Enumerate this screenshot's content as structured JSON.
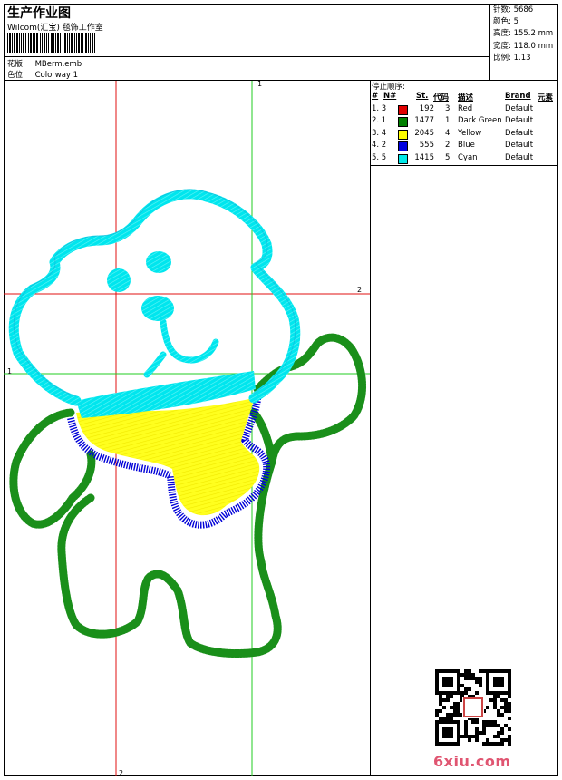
{
  "header": {
    "title": "生产作业图",
    "subtitle": "Wilcom(汇宝) 毯饰工作室",
    "pattern_label": "花版:",
    "pattern_value": "MBerm.emb",
    "colorway_label": "色位:",
    "colorway_value": "Colorway 1"
  },
  "stats": [
    {
      "label": "针数:",
      "value": "5686"
    },
    {
      "label": "颜色:",
      "value": "5"
    },
    {
      "label": "高度:",
      "value": "155.2 mm"
    },
    {
      "label": "宽度:",
      "value": "118.0 mm"
    },
    {
      "label": "比例:",
      "value": "1.13"
    }
  ],
  "legend": {
    "stop_order_label": "停止顺序:",
    "headers": {
      "num": "#",
      "n": "N#",
      "st": "St.",
      "code": "代码",
      "desc": "描述",
      "brand": "Brand",
      "element": "元素"
    },
    "rows": [
      {
        "order": "1. 3",
        "color": "#e00000",
        "st": "192",
        "code": "3",
        "desc": "Red",
        "brand": "Default"
      },
      {
        "order": "2. 1",
        "color": "#008000",
        "st": "1477",
        "code": "1",
        "desc": "Dark Green",
        "brand": "Default"
      },
      {
        "order": "3. 4",
        "color": "#ffff00",
        "st": "2045",
        "code": "4",
        "desc": "Yellow",
        "brand": "Default"
      },
      {
        "order": "4. 2",
        "color": "#0000e0",
        "st": "555",
        "code": "2",
        "desc": "Blue",
        "brand": "Default"
      },
      {
        "order": "5. 5",
        "color": "#00e8e8",
        "st": "1415",
        "code": "5",
        "desc": "Cyan",
        "brand": "Default"
      }
    ]
  },
  "guides": {
    "green_vertical_label": "1",
    "green_horizontal_label": "1",
    "red_horizontal_label": "2",
    "red_vertical_label": "2"
  },
  "colors": {
    "cyan": "#00e6ee",
    "green": "#1a8f1a",
    "yellow": "#ffff1e",
    "blue": "#0000d8",
    "red": "#e00000",
    "guide_red": "#e01010",
    "guide_green": "#22cc22",
    "site": "#e05571"
  },
  "footer": {
    "qr_icon": "qr-code-icon",
    "site": "6xiu.com"
  }
}
